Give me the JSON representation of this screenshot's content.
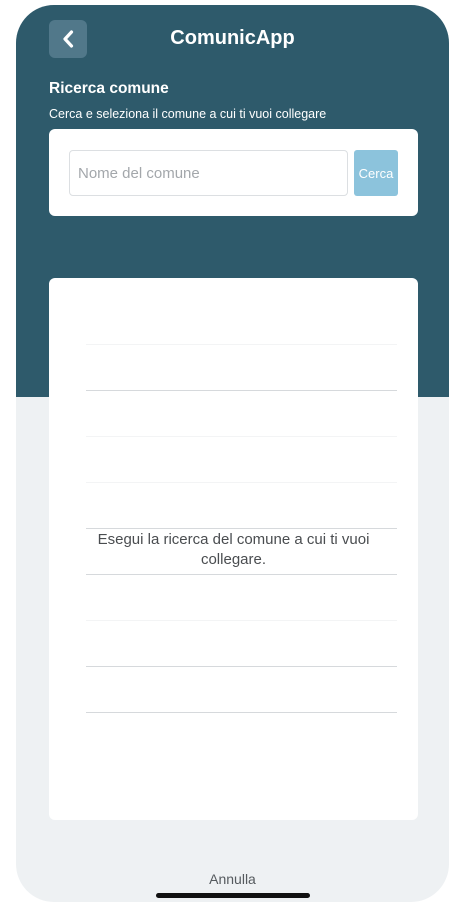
{
  "header": {
    "app_title": "ComunicApp",
    "back_icon": "chevron-left-icon"
  },
  "search_section": {
    "title": "Ricerca comune",
    "subtitle": "Cerca e seleziona il comune a cui ti vuoi collegare",
    "input_value": "",
    "input_placeholder": "Nome del comune",
    "button_label": "Cerca"
  },
  "results": {
    "empty_message": "Esegui la ricerca del comune a cui ti vuoi collegare."
  },
  "footer": {
    "cancel_label": "Annulla"
  },
  "colors": {
    "header_bg": "#2e5a6b",
    "page_bg": "#eef1f3",
    "search_button": "#8cc3dc"
  }
}
